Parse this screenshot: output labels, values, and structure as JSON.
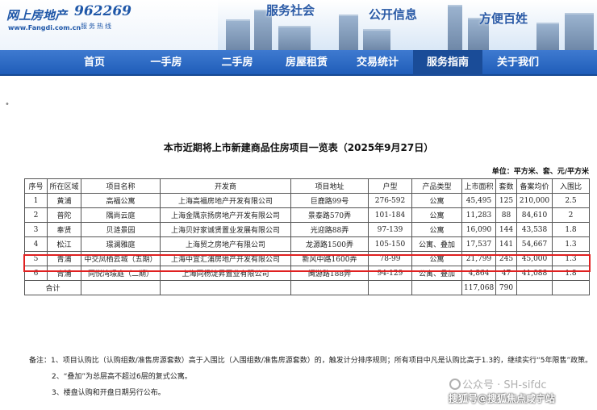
{
  "banner": {
    "logo_cn": "网上房地产",
    "logo_url": "www.Fangdi.com.cn",
    "hotline_number": "962269",
    "hotline_label": "服务热线",
    "slogans": [
      "服务社会",
      "公开信息",
      "方便百姓"
    ]
  },
  "nav": {
    "items": [
      "首页",
      "一手房",
      "二手房",
      "房屋租赁",
      "交易统计",
      "服务指南",
      "关于我们"
    ],
    "active": "服务指南"
  },
  "doc": {
    "title": "本市近期将上市新建商品住房项目一览表（2025年9月27日）",
    "unit_note": "单位：平方米、套、元/平方米",
    "columns": [
      "序号",
      "所在区域",
      "项目名称",
      "开发商",
      "项目地址",
      "户型",
      "产品类型",
      "上市面积",
      "套数",
      "备案均价",
      "入围比"
    ],
    "rows": [
      [
        "1",
        "黄浦",
        "高福公寓",
        "上海高福房地产开发有限公司",
        "巨鹿路99号",
        "276-592",
        "公寓",
        "45,495",
        "125",
        "210,000",
        "2.5"
      ],
      [
        "2",
        "普陀",
        "隅尚云庭",
        "上海金隅京扬房地产开发有限公司",
        "景泰路570弄",
        "101-184",
        "公寓",
        "11,283",
        "88",
        "84,610",
        "2"
      ],
      [
        "3",
        "奉贤",
        "贝涟景园",
        "上海贝好家诚贤置业发展有限公司",
        "光迎路88弄",
        "97-139",
        "公寓",
        "16,090",
        "144",
        "43,538",
        "1.8"
      ],
      [
        "4",
        "松江",
        "璟澜雅庭",
        "上海贸之房地产有限公司",
        "龙源路1500弄",
        "105-150",
        "公寓、叠加",
        "17,537",
        "141",
        "54,667",
        "1.3"
      ],
      [
        "5",
        "青浦",
        "中交凤栖云城（五期）",
        "上海中宜汇浦房地产开发有限公司",
        "新风中路1600弄",
        "78-99",
        "公寓",
        "21,799",
        "245",
        "45,000",
        "1.3"
      ],
      [
        "6",
        "青浦",
        "同悦湾璟庭（二期）",
        "上海同杨淀昇置业有限公司",
        "闽游路188弄",
        "94-129",
        "公寓、叠加",
        "4,864",
        "47",
        "41,088",
        "1.8"
      ]
    ],
    "total_label": "合计",
    "total_area": "117,068",
    "total_units": "790",
    "notes": [
      "备注：1、项目认购比（认购组数/准售房源套数）高于入围比（入围组数/准售房源套数）的，触发计分排序规则；所有项目中凡是认购比高于1.3的，继续实行“5年限售”政策。",
      "2、“叠加”为总层高不超过6层的复式公寓。",
      "3、楼盘认购和开盘日期另行公布。"
    ]
  },
  "watermarks": [
    "公众号 · SH-sifdc",
    "搜狐号@搜狐焦点咸宁站"
  ],
  "colors": {
    "nav_bg": "#2b69c4",
    "highlight": "#e02020",
    "brand_blue": "#1f57a8"
  }
}
